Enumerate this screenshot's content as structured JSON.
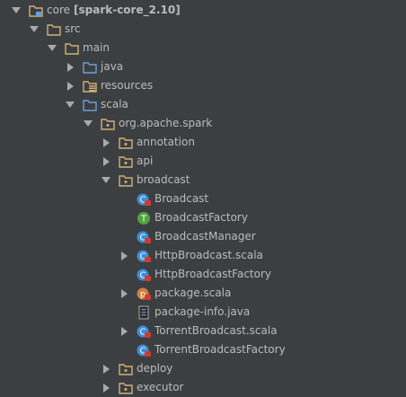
{
  "tree": {
    "root": {
      "label": "core",
      "module": "[spark-core_2.10]"
    },
    "items": [
      {
        "label": "src"
      },
      {
        "label": "main"
      },
      {
        "label": "java"
      },
      {
        "label": "resources"
      },
      {
        "label": "scala"
      },
      {
        "label": "org.apache.spark"
      },
      {
        "label": "annotation"
      },
      {
        "label": "api"
      },
      {
        "label": "broadcast"
      },
      {
        "label": "Broadcast"
      },
      {
        "label": "BroadcastFactory"
      },
      {
        "label": "BroadcastManager"
      },
      {
        "label": "HttpBroadcast.scala"
      },
      {
        "label": "HttpBroadcastFactory"
      },
      {
        "label": "package.scala"
      },
      {
        "label": "package-info.java"
      },
      {
        "label": "TorrentBroadcast.scala"
      },
      {
        "label": "TorrentBroadcastFactory"
      },
      {
        "label": "deploy"
      },
      {
        "label": "executor"
      }
    ]
  },
  "colors": {
    "background": "#3c3f41",
    "text": "#bbbbbb",
    "folder": "#d1b075",
    "source_folder": "#6a9fd4",
    "class_blue": "#3d8fd6",
    "trait_green": "#51a33f",
    "object_orange": "#d3803f",
    "scala_red": "#cf3b2e"
  }
}
